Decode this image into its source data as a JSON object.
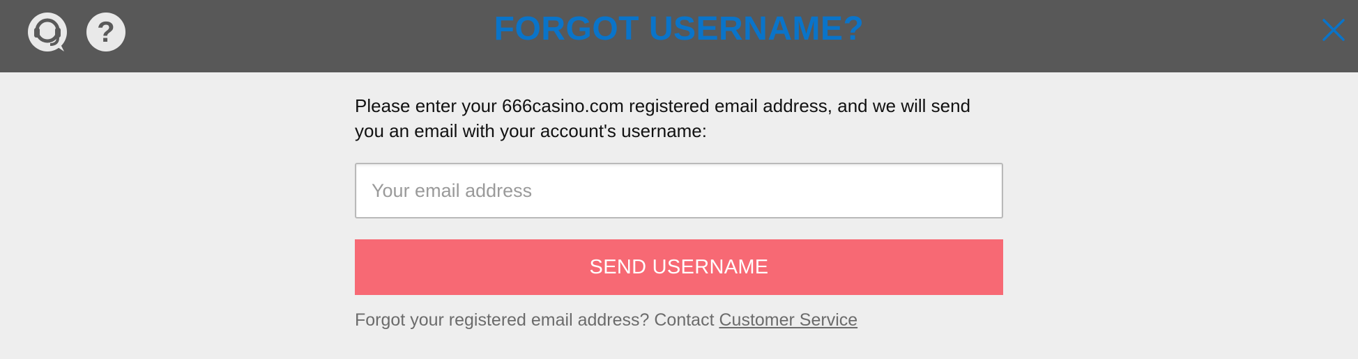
{
  "header": {
    "title": "FORGOT USERNAME?",
    "support_icon": "headset-support-icon",
    "help_icon": "question-mark-icon",
    "help_glyph": "?",
    "close_icon": "close-icon",
    "title_color": "#0a74c9",
    "background_color": "#585858"
  },
  "form": {
    "instructions": "Please enter your 666casino.com registered email address, and we will send you an email with your account's username:",
    "email_placeholder": "Your email address",
    "email_value": "",
    "submit_label": "SEND USERNAME",
    "submit_color": "#f76974"
  },
  "footer": {
    "text": "Forgot your registered email address? Contact ",
    "link_label": "Customer Service"
  }
}
